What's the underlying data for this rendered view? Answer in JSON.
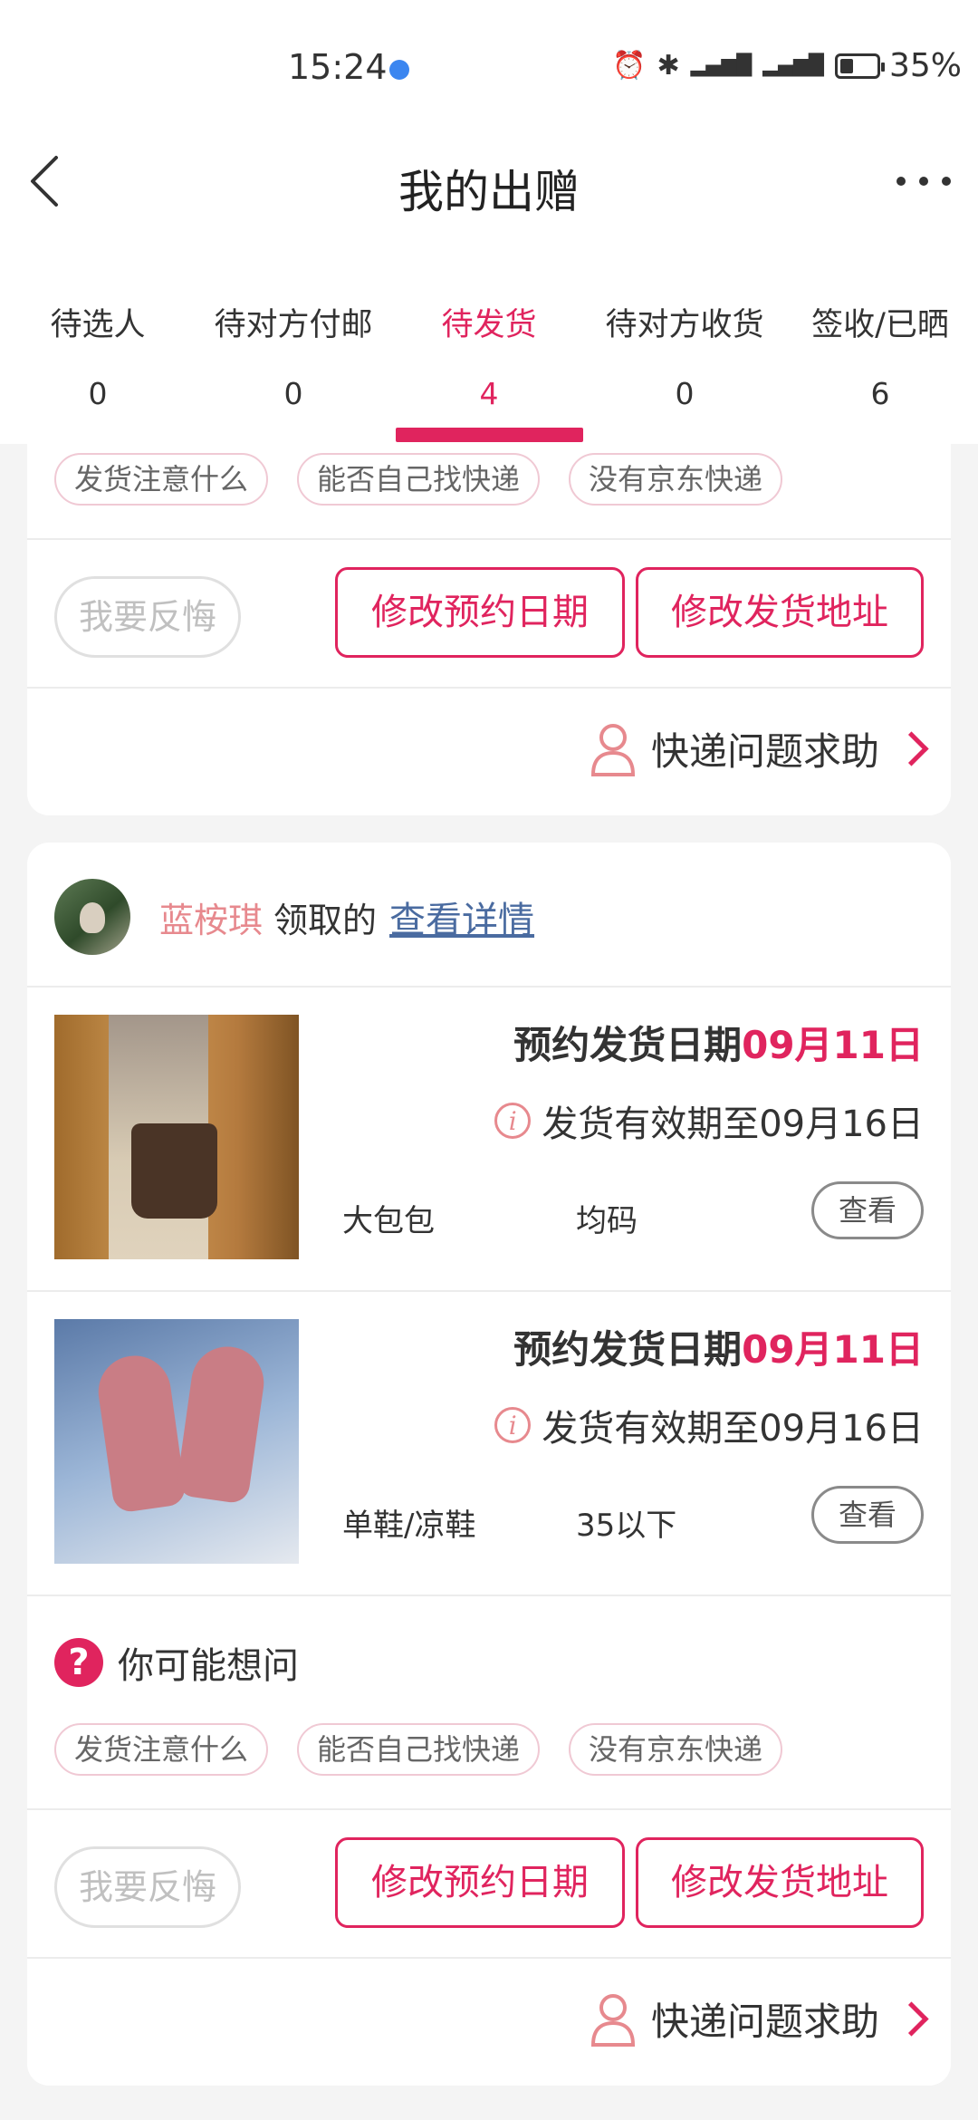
{
  "status_bar": {
    "time": "15:24",
    "battery": "35%",
    "network": "4G 5G"
  },
  "header": {
    "title": "我的出赠"
  },
  "tabs": [
    {
      "label": "待选人",
      "count": "0"
    },
    {
      "label": "待对方付邮",
      "count": "0"
    },
    {
      "label": "待发货",
      "count": "4"
    },
    {
      "label": "待对方收货",
      "count": "0"
    },
    {
      "label": "签收/已晒",
      "count": "6"
    }
  ],
  "cards": [
    {
      "faq_chips": [
        "发货注意什么",
        "能否自己找快递",
        "没有京东快递"
      ],
      "regret_label": "我要反悔",
      "change_date_label": "修改预约日期",
      "change_address_label": "修改发货地址",
      "help_label": "快递问题求助"
    },
    {
      "receiver": "蓝桉琪",
      "received_text": "领取的",
      "detail_link": "查看详情",
      "items": [
        {
          "ship_label": "预约发货日期",
          "ship_date": "09月11日",
          "validity": "发货有效期至09月16日",
          "name": "大包包",
          "size": "均码",
          "view_label": "查看"
        },
        {
          "ship_label": "预约发货日期",
          "ship_date": "09月11日",
          "validity": "发货有效期至09月16日",
          "name": "单鞋/凉鞋",
          "size": "35以下",
          "view_label": "查看"
        }
      ],
      "faq_title": "你可能想问",
      "faq_chips": [
        "发货注意什么",
        "能否自己找快递",
        "没有京东快递"
      ],
      "regret_label": "我要反悔",
      "change_date_label": "修改预约日期",
      "change_address_label": "修改发货地址",
      "help_label": "快递问题求助"
    }
  ],
  "colors": {
    "accent": "#e0245e",
    "receiver": "#e7898e",
    "link": "#4a6ba0",
    "background": "#f4f4f4"
  }
}
